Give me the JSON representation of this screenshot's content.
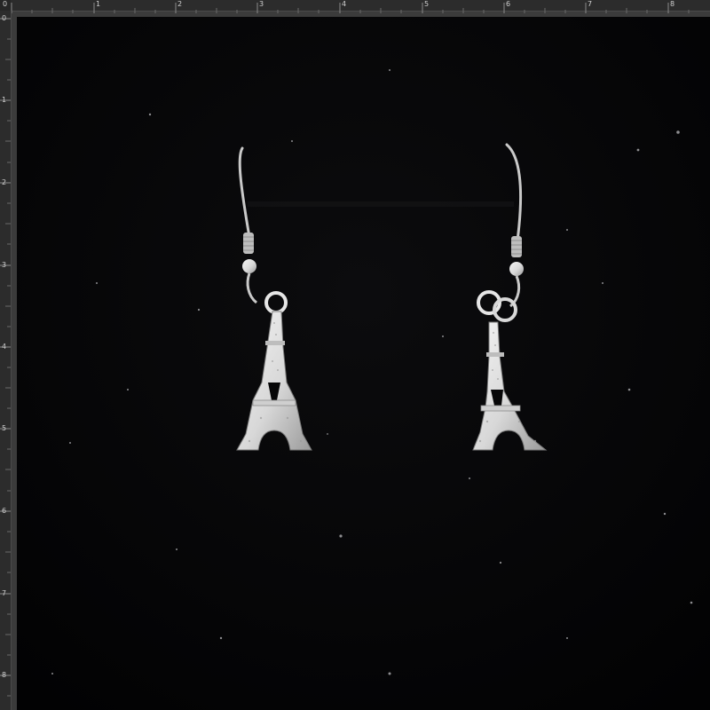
{
  "ruler": {
    "top_labels": [
      "0",
      "1",
      "2",
      "3",
      "4",
      "5",
      "6",
      "7",
      "8"
    ],
    "left_labels": [
      "0",
      "1",
      "2",
      "3",
      "4",
      "5",
      "6",
      "7",
      "8"
    ]
  },
  "photo": {
    "subject": "pair of silver Eiffel Tower earrings on black velvet",
    "background_color": "#050506",
    "metal_color": "#e6e6e6"
  }
}
